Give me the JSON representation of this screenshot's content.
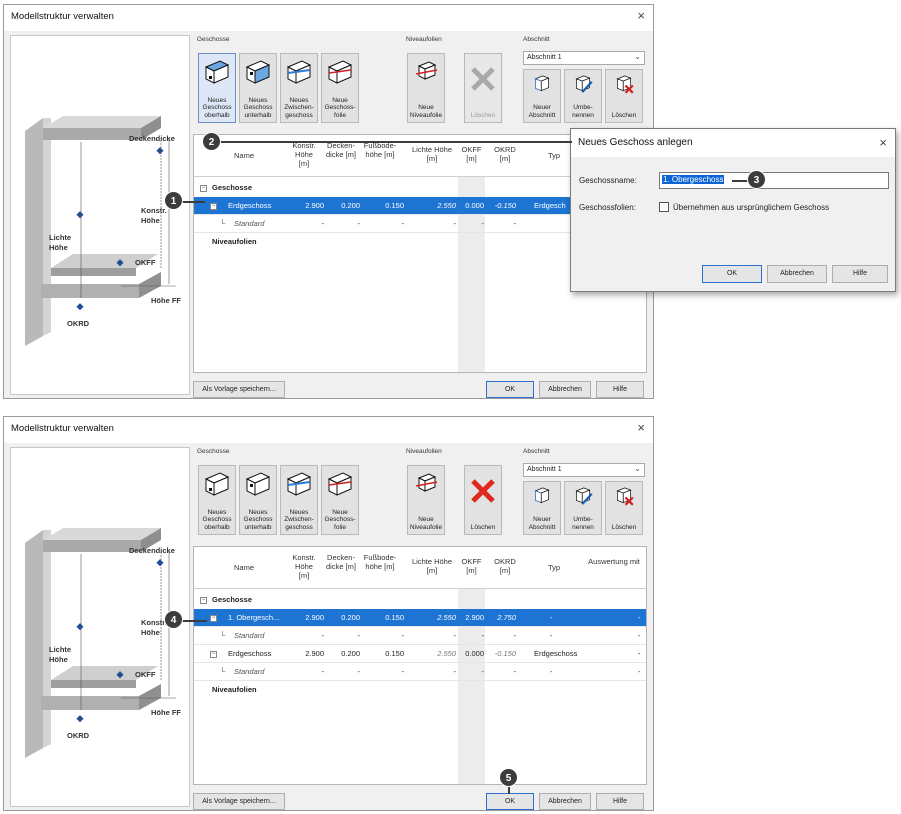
{
  "window": {
    "title": "Modellstruktur verwalten",
    "close": "×"
  },
  "groups": {
    "geschosse": "Geschosse",
    "niveaufolien": "Niveaufolien",
    "abschnitt": "Abschnitt"
  },
  "toolbar": {
    "neues_geschoss_oberhalb": "Neues Geschoss oberhalb",
    "neues_geschoss_unterhalb": "Neues Geschoss unterhalb",
    "neues_zwischengeschoss": "Neues Zwischen-geschoss",
    "neues_geschossfolie": "Neue Geschoss-folie",
    "neue_niveaufolie": "Neue Niveaufolie",
    "loeschen": "Löschen",
    "neuer_abschnitt": "Neuer Abschnitt",
    "umbenennen": "Umbe-nennen",
    "abschnitt_loeschen": "Löschen"
  },
  "abschnitt_select": {
    "value": "Abschnitt 1",
    "arrow": "⌄"
  },
  "illustration": {
    "deckendicke": "Deckendicke",
    "konstr_hoehe": "Konstr. Höhe",
    "lichte_hoehe": "Lichte Höhe",
    "okff": "OKFF",
    "hoehe_ff": "Höhe FF",
    "okrd": "OKRD"
  },
  "grid": {
    "columns": {
      "name": "Name",
      "konstr": "Konstr. Höhe [m]",
      "decken": "Decken-dicke [m]",
      "fussboden": "Fußbode-höhe [m]",
      "lichte": "Lichte Höhe [m]",
      "okff": "OKFF [m]",
      "okrd": "OKRD [m]",
      "typ": "Typ",
      "auswertung": "Auswertung mit"
    },
    "section_geschosse": "Geschosse",
    "section_niveaufolien": "Niveaufolien"
  },
  "table1": {
    "rows": [
      {
        "name": "Erdgeschoss",
        "konstr": "2.900",
        "decken": "0.200",
        "fuss": "0.150",
        "lichte": "2.550",
        "okff": "0.000",
        "okrd": "-0.150",
        "typ": "Erdgesch"
      },
      {
        "name": "Standard",
        "konstr": "-",
        "decken": "-",
        "fuss": "-",
        "lichte": "-",
        "okff": "-",
        "okrd": "-",
        "typ": ""
      }
    ]
  },
  "table2": {
    "rows": [
      {
        "name": "1. Obergesch...",
        "konstr": "2.900",
        "decken": "0.200",
        "fuss": "0.150",
        "lichte": "2.550",
        "okff": "2.900",
        "okrd": "2.750",
        "typ": "-",
        "ausw": "-"
      },
      {
        "name": "Standard",
        "konstr": "-",
        "decken": "-",
        "fuss": "-",
        "lichte": "-",
        "okff": "-",
        "okrd": "-",
        "typ": "-",
        "ausw": "-"
      },
      {
        "name": "Erdgeschoss",
        "konstr": "2.900",
        "decken": "0.200",
        "fuss": "0.150",
        "lichte": "2.550",
        "okff": "0.000",
        "okrd": "-0.150",
        "typ": "Erdgeschoss",
        "ausw": "-"
      },
      {
        "name": "Standard",
        "konstr": "-",
        "decken": "-",
        "fuss": "-",
        "lichte": "-",
        "okff": "-",
        "okrd": "-",
        "typ": "-",
        "ausw": "-"
      }
    ]
  },
  "footer": {
    "als_vorlage": "Als Vorlage speichern...",
    "ok": "OK",
    "abbrechen": "Abbrechen",
    "hilfe": "Hilfe"
  },
  "dialog": {
    "title": "Neues Geschoss anlegen",
    "close": "×",
    "geschossname_label": "Geschossname:",
    "geschossname_value": "1. Obergeschoss",
    "geschossfolien_label": "Geschossfolien:",
    "checkbox_label": "Übernehmen aus ursprünglichem Geschoss",
    "checkbox_checked": false,
    "ok": "OK",
    "abbrechen": "Abbrechen",
    "hilfe": "Hilfe"
  },
  "markers": {
    "m1": "1",
    "m2": "2",
    "m3": "3",
    "m4": "4",
    "m5": "5"
  },
  "colors": {
    "selection": "#1e74d2",
    "marker": "#3c3c3c",
    "delete_red": "#e0281e",
    "delete_disabled": "#a8a8a8"
  }
}
